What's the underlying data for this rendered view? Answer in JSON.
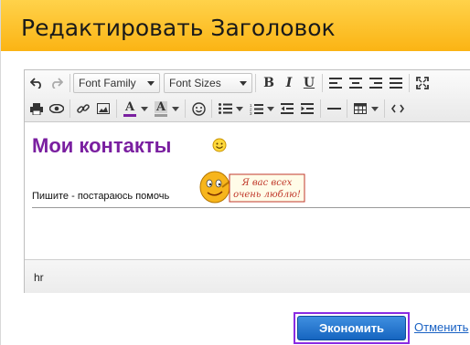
{
  "dialog": {
    "title": "Редактировать Заголовок"
  },
  "toolbar": {
    "font_family": "Font Family",
    "font_sizes": "Font Sizes",
    "icons": [
      "undo-icon",
      "redo-icon",
      "bold-icon",
      "italic-icon",
      "underline-icon",
      "align-left-icon",
      "align-center-icon",
      "align-right-icon",
      "justify-icon",
      "fullscreen-icon",
      "print-icon",
      "preview-icon",
      "link-icon",
      "image-icon",
      "text-color-icon",
      "background-color-icon",
      "emoticon-icon",
      "bullet-list-icon",
      "numbered-list-icon",
      "outdent-icon",
      "indent-icon",
      "horizontal-rule-icon",
      "table-icon",
      "code-icon"
    ],
    "bold": "B",
    "italic": "I",
    "underline": "U",
    "text_color_letter": "A",
    "bg_color_letter": "A",
    "text_color": "#7a1fa0",
    "bg_color": "#9a9a9a"
  },
  "content": {
    "heading": "Мои контакты",
    "paragraph": "Пишите - постараюсь помочь",
    "sticker_line1": "Я вас всех",
    "sticker_line2": "очень люблю!"
  },
  "statusbar": {
    "path": "hr"
  },
  "actions": {
    "save": "Экономить",
    "cancel": "Отменить"
  },
  "colors": {
    "title_bar": "#fbb414",
    "save_button": "#1665c0",
    "focus_outline": "#8a2be2",
    "heading": "#7a1fa0",
    "link": "#1a62c4"
  }
}
